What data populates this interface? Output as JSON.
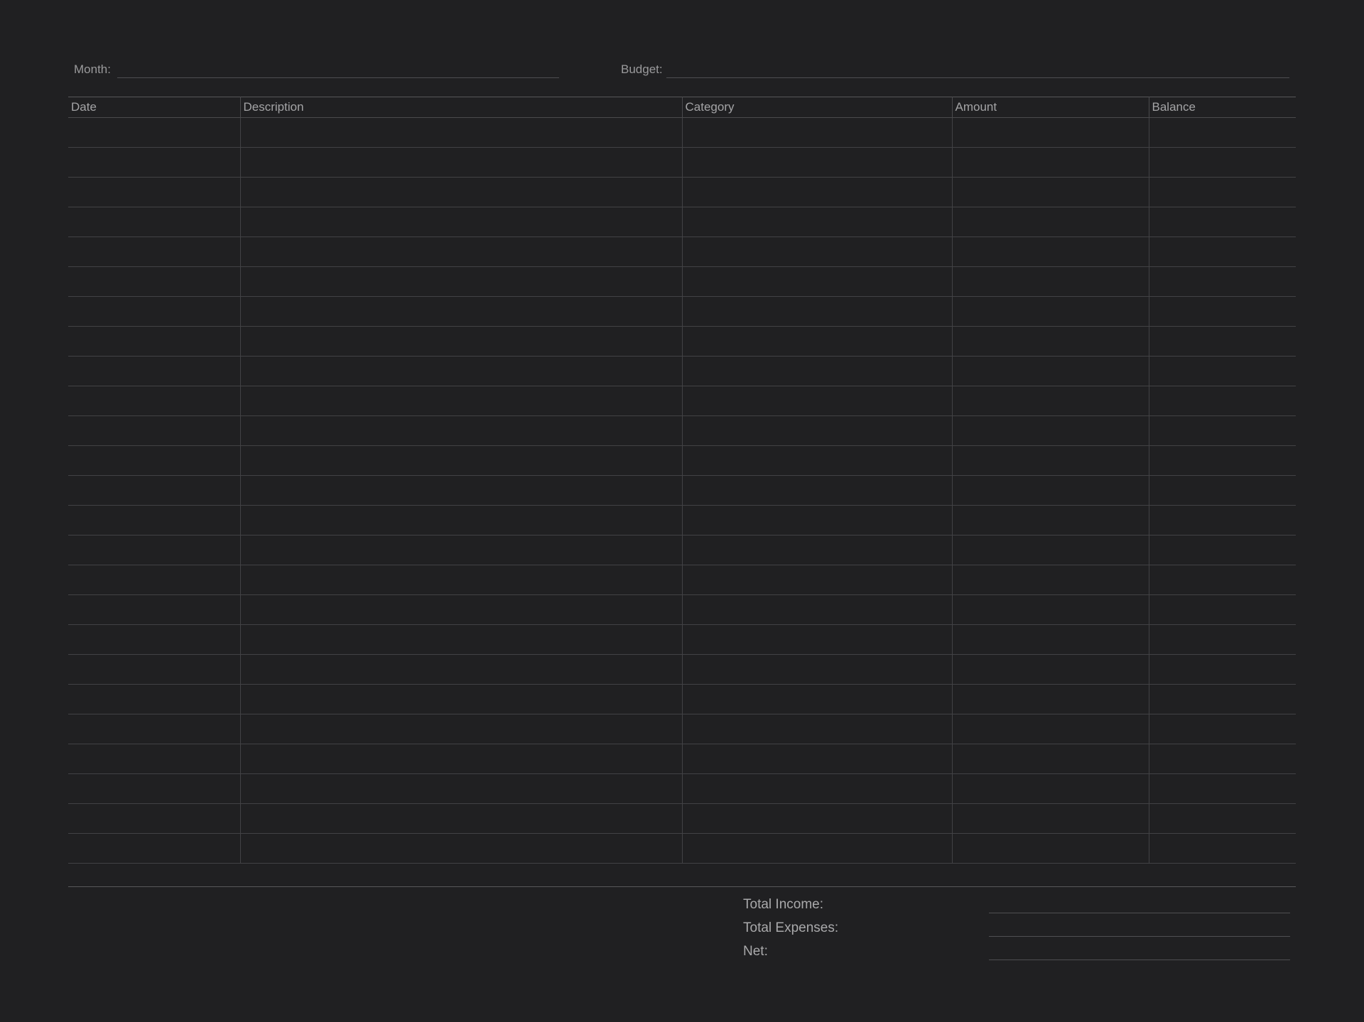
{
  "header": {
    "month_label": "Month:",
    "budget_label": "Budget:"
  },
  "table": {
    "columns": [
      "Date",
      "Description",
      "Category",
      "Amount",
      "Balance"
    ],
    "empty_rows": 25
  },
  "totals": {
    "income_label": "Total Income:",
    "expenses_label": "Total Expenses:",
    "net_label": "Net:"
  }
}
